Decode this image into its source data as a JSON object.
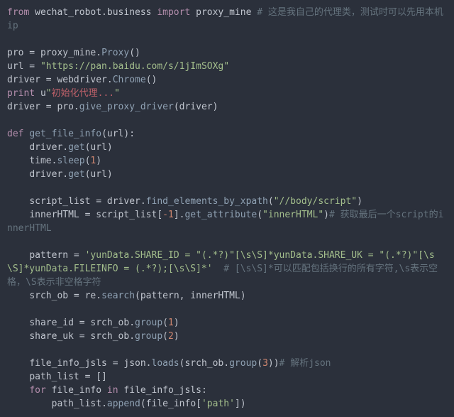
{
  "code": {
    "l1": {
      "kw1": "from",
      "mod1": " wechat_robot.business ",
      "kw2": "import",
      "mod2": " proxy_mine ",
      "com": "# 这是我自己的代理类，测试时可以先用本机ip"
    },
    "l2": "",
    "l3": {
      "a": "pro = proxy_mine.",
      "fn": "Proxy",
      "b": "()"
    },
    "l4": {
      "a": "url = ",
      "s": "\"https://pan.baidu.com/s/1jImSOXg\""
    },
    "l5": {
      "a": "driver = webdriver.",
      "fn": "Chrome",
      "b": "()"
    },
    "l6": {
      "kw": "print",
      "u": " u",
      "q1": "\"",
      "zh": "初始化代理...",
      "q2": "\""
    },
    "l7": {
      "a": "driver = pro.",
      "fn": "give_proxy_driver",
      "b": "(driver)"
    },
    "l8": "",
    "l9": {
      "kw": "def",
      "sp": " ",
      "fn": "get_file_info",
      "sig": "(url):"
    },
    "l10": {
      "ind": "    ",
      "a": "driver.",
      "fn": "get",
      "b": "(url)"
    },
    "l11": {
      "ind": "    ",
      "a": "time.",
      "fn": "sleep",
      "b": "(",
      "n": "1",
      "c": ")"
    },
    "l12": {
      "ind": "    ",
      "a": "driver.",
      "fn": "get",
      "b": "(url)"
    },
    "l13": "",
    "l14": {
      "ind": "    ",
      "a": "script_list = driver.",
      "fn": "find_elements_by_xpath",
      "b": "(",
      "s": "\"//body/script\"",
      "c": ")"
    },
    "l15": {
      "ind": "    ",
      "a": "innerHTML = script_list[",
      "n": "-1",
      "b": "].",
      "fn": "get_attribute",
      "c": "(",
      "s": "\"innerHTML\"",
      "d": ")",
      "com": "# 获取最后一个script的innerHTML"
    },
    "l16": "",
    "l17": {
      "ind": "    ",
      "a": "pattern = ",
      "s": "'yunData.SHARE_ID = \"(.*?)\"[\\s\\S]*yunData.SHARE_UK = \"(.*?)\"[\\s\\S]*yunData.FILEINFO = (.*?);[\\s\\S]*'",
      "sp": "  ",
      "com": "# [\\s\\S]*可以匹配包括换行的所有字符,\\s表示空格，\\S表示非空格字符"
    },
    "l18": {
      "ind": "    ",
      "a": "srch_ob = re.",
      "fn": "search",
      "b": "(pattern, innerHTML)"
    },
    "l19": "",
    "l20": {
      "ind": "    ",
      "a": "share_id = srch_ob.",
      "fn": "group",
      "b": "(",
      "n": "1",
      "c": ")"
    },
    "l21": {
      "ind": "    ",
      "a": "share_uk = srch_ob.",
      "fn": "group",
      "b": "(",
      "n": "2",
      "c": ")"
    },
    "l22": "",
    "l23": {
      "ind": "    ",
      "a": "file_info_jsls = json.",
      "fn": "loads",
      "b": "(srch_ob.",
      "fn2": "group",
      "c": "(",
      "n": "3",
      "d": "))",
      "com": "# 解析json"
    },
    "l24": {
      "ind": "    ",
      "a": "path_list = []"
    },
    "l25": {
      "ind": "    ",
      "kw1": "for",
      "a": " file_info ",
      "kw2": "in",
      "b": " file_info_jsls:"
    },
    "l26": {
      "ind": "        ",
      "a": "path_list.",
      "fn": "append",
      "b": "(file_info[",
      "s": "'path'",
      "c": "])"
    }
  }
}
